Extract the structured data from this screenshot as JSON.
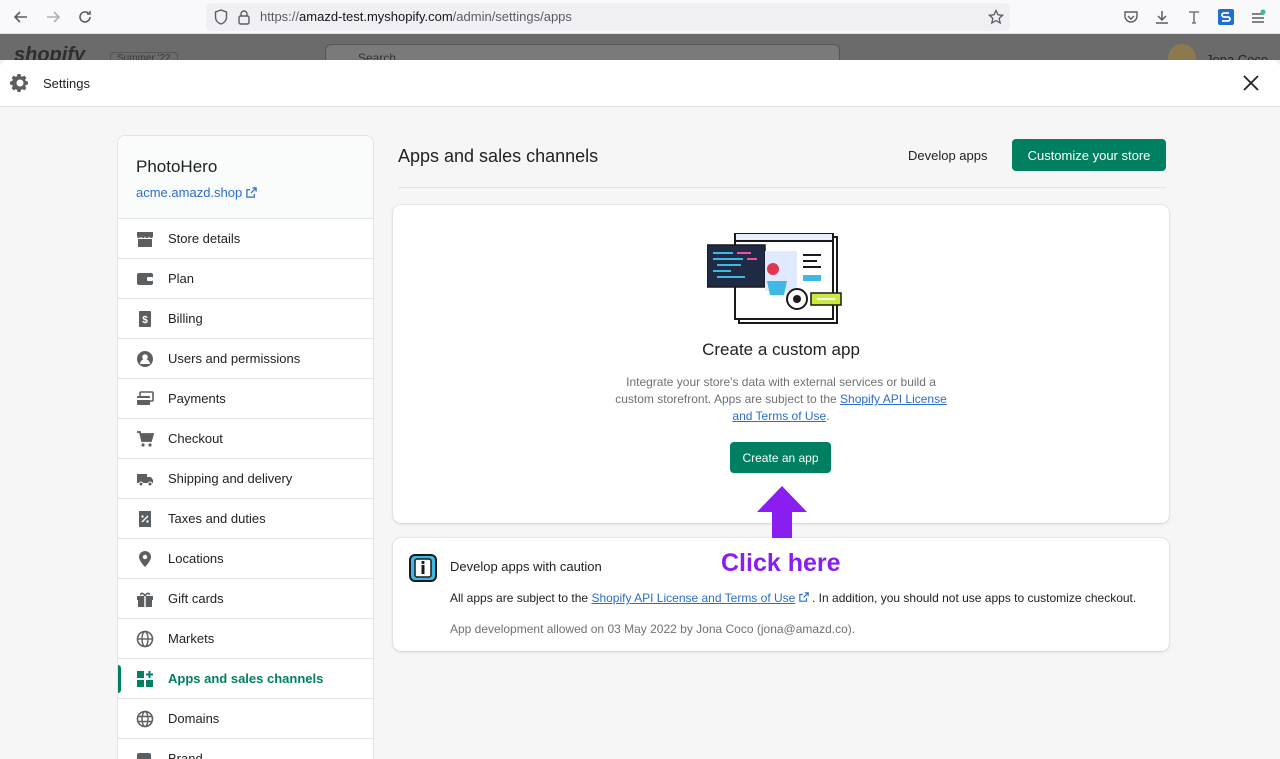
{
  "browser": {
    "url_scheme": "https://",
    "url_host": "amazd-test.myshopify.com",
    "url_path": "/admin/settings/apps"
  },
  "admin": {
    "logo_text": "shopify",
    "store_badge": "Summer '22",
    "search_placeholder": "Search",
    "user_name": "Jona Coco"
  },
  "settings": {
    "title": "Settings"
  },
  "store": {
    "name": "PhotoHero",
    "domain": "acme.amazd.shop"
  },
  "sidebar": {
    "items": [
      {
        "label": "Store details",
        "icon": "store-icon"
      },
      {
        "label": "Plan",
        "icon": "plan-icon"
      },
      {
        "label": "Billing",
        "icon": "billing-icon"
      },
      {
        "label": "Users and permissions",
        "icon": "user-icon"
      },
      {
        "label": "Payments",
        "icon": "payments-icon"
      },
      {
        "label": "Checkout",
        "icon": "cart-icon"
      },
      {
        "label": "Shipping and delivery",
        "icon": "truck-icon"
      },
      {
        "label": "Taxes and duties",
        "icon": "tax-icon"
      },
      {
        "label": "Locations",
        "icon": "location-pin-icon"
      },
      {
        "label": "Gift cards",
        "icon": "gift-icon"
      },
      {
        "label": "Markets",
        "icon": "markets-globe-icon"
      },
      {
        "label": "Apps and sales channels",
        "icon": "apps-icon",
        "active": true
      },
      {
        "label": "Domains",
        "icon": "domains-globe-icon"
      },
      {
        "label": "Brand",
        "icon": "brand-icon"
      }
    ]
  },
  "main": {
    "title": "Apps and sales channels",
    "develop_apps_label": "Develop apps",
    "customize_label": "Customize your store"
  },
  "create_card": {
    "title": "Create a custom app",
    "desc_text": "Integrate your store's data with external services or build a custom storefront. Apps are subject to the",
    "desc_link": "Shopify API License and Terms of Use",
    "desc_end": ".",
    "button_label": "Create an app"
  },
  "caution_card": {
    "title": "Develop apps with caution",
    "body_prefix": "All apps are subject to the",
    "body_link": "Shopify API License and Terms of Use",
    "body_suffix": ". In addition, you should not use apps to customize checkout.",
    "meta": "App development allowed on 03 May 2022 by Jona Coco (jona@amazd.co)."
  },
  "annotation": {
    "text": "Click here",
    "color": "#8a1df0"
  },
  "colors": {
    "primary": "#008060",
    "link": "#2c6ecb"
  }
}
